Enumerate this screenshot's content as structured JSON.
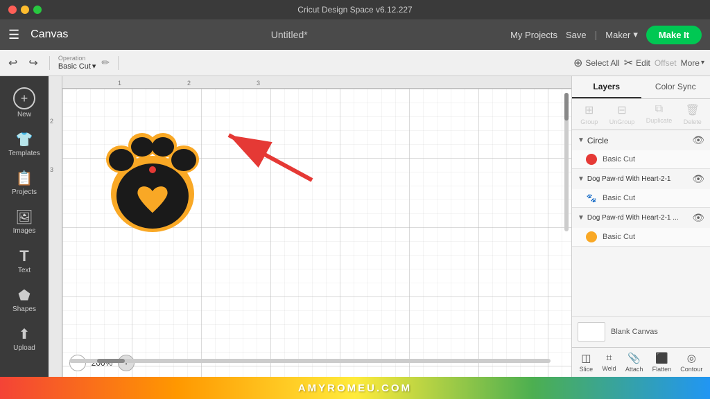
{
  "window": {
    "title": "Cricut Design Space  v6.12.227",
    "controls": {
      "close": "×",
      "minimize": "−",
      "maximize": "+"
    }
  },
  "navbar": {
    "hamburger": "☰",
    "canvas_label": "Canvas",
    "document_title": "Untitled*",
    "my_projects": "My Projects",
    "save": "Save",
    "divider": "|",
    "maker": "Maker",
    "make_it": "Make It"
  },
  "toolbar": {
    "undo_icon": "↩",
    "redo_icon": "↪",
    "operation_label": "Operation",
    "operation_value": "Basic Cut",
    "edit_label": "Edit",
    "select_all_label": "Select All",
    "offset_label": "Offset",
    "more_label": "More"
  },
  "sidebar": {
    "items": [
      {
        "id": "new",
        "icon": "+",
        "label": "New",
        "is_circle": true
      },
      {
        "id": "templates",
        "icon": "👕",
        "label": "Templates"
      },
      {
        "id": "projects",
        "icon": "📋",
        "label": "Projects"
      },
      {
        "id": "images",
        "icon": "🖼",
        "label": "Images"
      },
      {
        "id": "text",
        "icon": "T",
        "label": "Text"
      },
      {
        "id": "shapes",
        "icon": "⬟",
        "label": "Shapes"
      },
      {
        "id": "upload",
        "icon": "⬆",
        "label": "Upload"
      }
    ]
  },
  "canvas": {
    "zoom_value": "200%",
    "ruler_marks": [
      "1",
      "2",
      "3"
    ],
    "ruler_side_marks": [
      "2",
      "3"
    ]
  },
  "right_panel": {
    "tabs": [
      {
        "id": "layers",
        "label": "Layers",
        "active": true
      },
      {
        "id": "color_sync",
        "label": "Color Sync"
      }
    ],
    "actions": [
      {
        "id": "group",
        "label": "Group",
        "icon": "⊞",
        "disabled": true
      },
      {
        "id": "ungroup",
        "label": "UnGroup",
        "icon": "⊟",
        "disabled": true
      },
      {
        "id": "duplicate",
        "label": "Duplicate",
        "icon": "⧉",
        "disabled": true
      },
      {
        "id": "delete",
        "label": "Delete",
        "icon": "🗑",
        "disabled": true
      }
    ],
    "layers": [
      {
        "id": "circle",
        "name": "Circle",
        "expanded": true,
        "items": [
          {
            "id": "circle-cut",
            "color": "#e53935",
            "label": "Basic Cut"
          }
        ]
      },
      {
        "id": "dog-paw-1",
        "name": "Dog Paw-rd With Heart-2-1",
        "expanded": true,
        "items": [
          {
            "id": "paw1-cut",
            "color": "#222",
            "label": "Basic Cut",
            "is_paw": true
          }
        ]
      },
      {
        "id": "dog-paw-2",
        "name": "Dog Paw-rd With Heart-2-1 ...",
        "expanded": true,
        "items": [
          {
            "id": "paw2-cut",
            "color": "#f9a825",
            "label": "Basic Cut",
            "is_star": true
          }
        ]
      }
    ],
    "blank_canvas": {
      "label": "Blank Canvas"
    },
    "bottom_actions": [
      {
        "id": "slice",
        "label": "Slice",
        "icon": "◫",
        "disabled": false
      },
      {
        "id": "weld",
        "label": "Weld",
        "icon": "⌗",
        "disabled": false
      },
      {
        "id": "attach",
        "label": "Attach",
        "icon": "📎",
        "disabled": false
      },
      {
        "id": "flatten",
        "label": "Flatten",
        "icon": "⬛",
        "disabled": false
      },
      {
        "id": "contour",
        "label": "Contour",
        "icon": "◎",
        "disabled": false
      }
    ]
  },
  "brand": {
    "text": "AMYROMEU.COM"
  },
  "colors": {
    "accent_green": "#00c853",
    "paw_black": "#1a1a1a",
    "paw_gold": "#f9a825",
    "circle_red": "#e53935",
    "bg_dark": "#3a3a3a",
    "bg_toolbar": "#f0f0f0"
  }
}
